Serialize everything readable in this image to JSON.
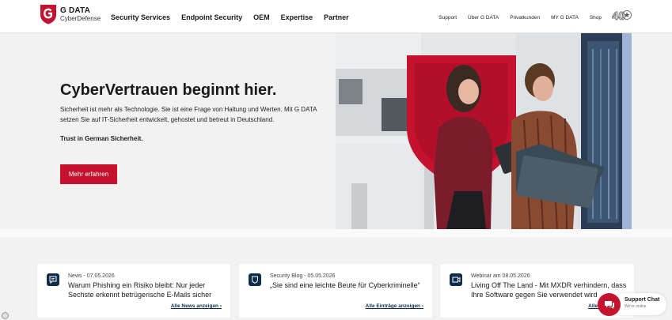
{
  "brand": {
    "name": "G DATA",
    "subtitle": "CyberDefense",
    "accent": "#c4122f",
    "navy": "#0e2d4b"
  },
  "nav_main": [
    "Security Services",
    "Endpoint Security",
    "OEM",
    "Expertise",
    "Partner"
  ],
  "nav_util": [
    "Support",
    "Über G DATA",
    "Privatkunden",
    "MY G DATA",
    "Shop"
  ],
  "anniversary_badge": "40",
  "hero": {
    "title": "CyberVertrauen beginnt hier.",
    "text": "Sicherheit ist mehr als Technologie. Sie ist eine Frage von Haltung und Werten. Mit G DATA setzen Sie auf IT-Sicherheit entwickelt, gehostet und betreut in Deutschland.",
    "strong": "Trust in German Sicherheit.",
    "cta": "Mehr erfahren"
  },
  "cards": [
    {
      "icon": "chat-news-icon",
      "meta": "News - 07.05.2026",
      "title": "Warum Phishing ein Risiko bleibt: Nur jeder Sechste erkennt betrügerische E-Mails sicher",
      "link": "Alle News anzeigen ›"
    },
    {
      "icon": "shield-icon",
      "meta": "Security Blog - 05.05.2026",
      "title": "„Sie sind eine leichte Beute für Cyberkriminelle“",
      "link": "Alle Einträge anzeigen ›"
    },
    {
      "icon": "video-icon",
      "meta": "Webinar am 08.05.2026",
      "title": "Living Off The Land - Mit MXDR verhindern, dass Ihre Software gegen Sie verwendet wird",
      "link": "Alle Webinare ›"
    }
  ],
  "chat": {
    "title": "Support Chat",
    "status": "We're online"
  }
}
